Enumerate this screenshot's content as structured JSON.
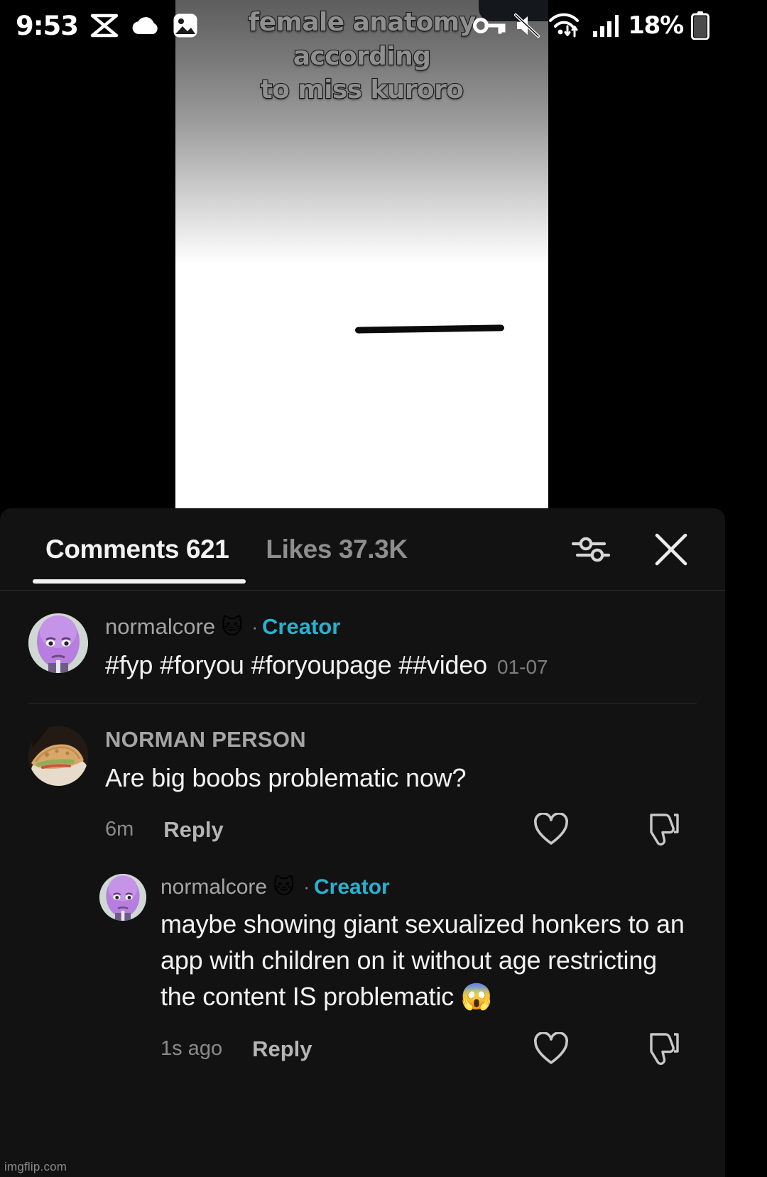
{
  "status_bar": {
    "time": "9:53",
    "battery_percent": "18%",
    "left_icons": [
      "capcut-icon",
      "cloud-icon",
      "photo-icon"
    ],
    "right_icons": [
      "vpn-key-icon",
      "mute-icon",
      "wifi-icon",
      "signal-bars-icon",
      "battery-icon"
    ]
  },
  "video": {
    "caption": "female anatomy according\nto miss kuroro",
    "caption_color": "#8f8f8f"
  },
  "sheet": {
    "tab_comments": "Comments 621",
    "tab_likes": "Likes 37.3K",
    "filter_icon": "filter-sliders-icon",
    "close_icon": "close-icon"
  },
  "comments": [
    {
      "author": "normalcore",
      "author_emoji": "🐱",
      "separator": "·",
      "badge": "Creator",
      "badge_color": "#27b2d0",
      "text": "#fyp #foryou #foryoupage ##video",
      "inline_date": "01-07",
      "avatar": "normalcore-avatar",
      "has_meta_row": false
    },
    {
      "author": "NORMAN PERSON",
      "author_emoji": "",
      "separator": "",
      "badge": "",
      "text": "Are big boobs problematic now?",
      "inline_date": "",
      "avatar": "food-avatar",
      "has_meta_row": true,
      "time": "6m",
      "reply_label": "Reply",
      "like_icon": "heart-outline-icon",
      "dislike_icon": "thumbs-down-outline-icon"
    },
    {
      "author": "normalcore",
      "author_emoji": "🐱",
      "separator": "·",
      "badge": "Creator",
      "badge_color": "#27b2d0",
      "text": "maybe showing giant sexualized honkers to an app with children on it without age restricting the content IS problematic 😱",
      "inline_date": "",
      "avatar": "normalcore-avatar",
      "is_reply": true,
      "has_meta_row": true,
      "time": "1s ago",
      "reply_label": "Reply",
      "like_icon": "heart-outline-icon",
      "dislike_icon": "thumbs-down-outline-icon"
    }
  ],
  "watermark": "imgflip.com"
}
